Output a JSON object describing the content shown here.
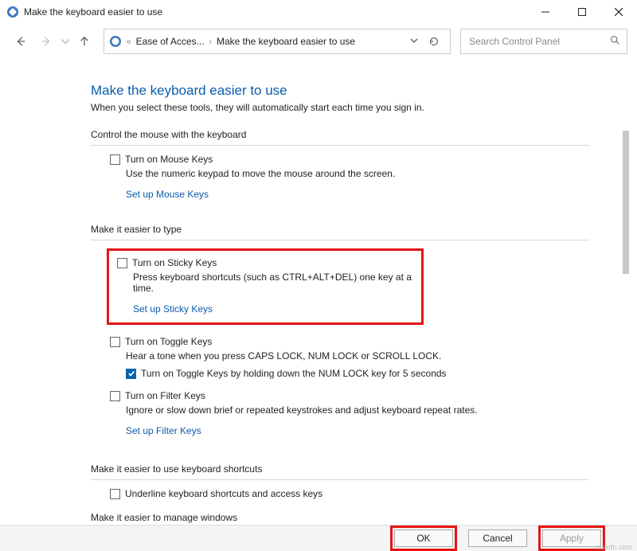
{
  "window": {
    "title": "Make the keyboard easier to use"
  },
  "breadcrumb": {
    "part1": "Ease of Acces...",
    "part2": "Make the keyboard easier to use"
  },
  "search": {
    "placeholder": "Search Control Panel"
  },
  "page": {
    "title": "Make the keyboard easier to use",
    "subtitle": "When you select these tools, they will automatically start each time you sign in."
  },
  "sections": {
    "mouse": {
      "label": "Control the mouse with the keyboard",
      "chk": "Turn on Mouse Keys",
      "desc": "Use the numeric keypad to move the mouse around the screen.",
      "link": "Set up Mouse Keys"
    },
    "type": {
      "label": "Make it easier to type",
      "sticky": {
        "chk": "Turn on Sticky Keys",
        "desc": "Press keyboard shortcuts (such as CTRL+ALT+DEL) one key at a time.",
        "link": "Set up Sticky Keys"
      },
      "toggle": {
        "chk": "Turn on Toggle Keys",
        "desc": "Hear a tone when you press CAPS LOCK, NUM LOCK or SCROLL LOCK.",
        "subchk": "Turn on Toggle Keys by holding down the NUM LOCK key for 5 seconds"
      },
      "filter": {
        "chk": "Turn on Filter Keys",
        "desc": "Ignore or slow down brief or repeated keystrokes and adjust keyboard repeat rates.",
        "link": "Set up Filter Keys"
      }
    },
    "shortcuts": {
      "label": "Make it easier to use keyboard shortcuts",
      "chk": "Underline keyboard shortcuts and access keys"
    },
    "windows": {
      "label": "Make it easier to manage windows"
    }
  },
  "buttons": {
    "ok": "OK",
    "cancel": "Cancel",
    "apply": "Apply"
  },
  "watermark": "wsxdn.com"
}
